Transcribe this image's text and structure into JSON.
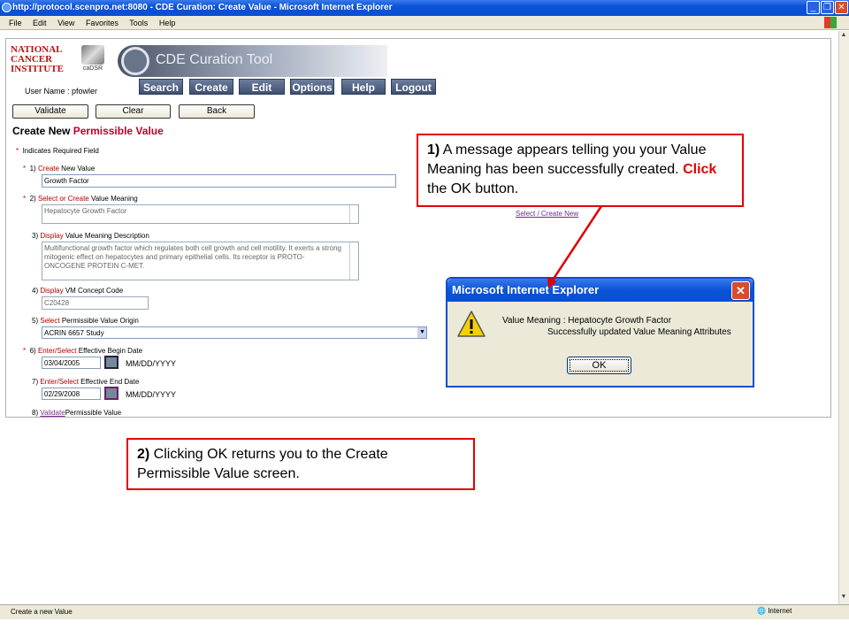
{
  "browser": {
    "title": "http://protocol.scenpro.net:8080 - CDE Curation: Create Value - Microsoft Internet Explorer",
    "menu": [
      "File",
      "Edit",
      "View",
      "Favorites",
      "Tools",
      "Help"
    ],
    "status_text": "Create a new Value",
    "zone": "Internet"
  },
  "header": {
    "nci_logo": [
      "NATIONAL",
      "CANCER",
      "INSTITUTE"
    ],
    "cadsr_logo": "caDSR",
    "app_title": "CDE Curation Tool",
    "user_name": "User Name : pfowler",
    "nav": [
      "Search",
      "Create",
      "Edit",
      "Options",
      "Help",
      "Logout"
    ]
  },
  "actions": {
    "validate": "Validate",
    "clear": "Clear",
    "back": "Back"
  },
  "page": {
    "title_prefix": "Create New",
    "title_highlight": "Permissible Value",
    "required_note": "Indicates Required Field",
    "fields": {
      "f1": {
        "num": "1)",
        "link": "Create",
        "rest": " New Value",
        "value": "Growth Factor"
      },
      "f2": {
        "num": "2)",
        "link": "Select or Create",
        "rest": " Value Meaning",
        "value": "Hepatocyte Growth Factor"
      },
      "f3": {
        "num": "3)",
        "link": "Display",
        "rest": " Value Meaning Description",
        "value": "Multifunctional growth factor which regulates both cell growth and cell motility. It exerts a strong mitogenic effect on hepatocytes and primary epithelial cells. Its receptor is PROTO-ONCOGENE PROTEIN C-MET."
      },
      "f4": {
        "num": "4)",
        "link": "Display",
        "rest": " VM Concept Code",
        "value": "C20428"
      },
      "f5": {
        "num": "5)",
        "link": "Select",
        "rest": " Permissible Value Origin",
        "value": "ACRIN 6657 Study"
      },
      "f6": {
        "num": "6)",
        "link": "Enter/Select",
        "rest": " Effective Begin Date",
        "value": "03/04/2005",
        "format": "MM/DD/YYYY"
      },
      "f7": {
        "num": "7)",
        "link": "Enter/Select",
        "rest": " Effective End Date",
        "value": "02/29/2008",
        "format": "MM/DD/YYYY"
      },
      "f8": {
        "num": "8)",
        "link": "Validate",
        "rest": "Permissible Value"
      }
    },
    "select_create_link": "Select / Create New"
  },
  "dialog": {
    "title": "Microsoft Internet Explorer",
    "msg1": "Value Meaning : Hepatocyte Growth Factor",
    "msg2": "Successfully updated Value Meaning Attributes",
    "ok": "OK"
  },
  "callout1": {
    "num": "1)",
    "text_a": " A message appears telling you your Value Meaning has been successfully created. ",
    "click": "Click",
    "text_b": " the OK button."
  },
  "callout2": {
    "num": "2)",
    "text": " Clicking OK returns you to the Create Permissible Value screen."
  },
  "colors": {
    "accent_red": "#e00000",
    "ie_blue": "#0a4fd0",
    "nav_blue": "#3e4f70"
  }
}
